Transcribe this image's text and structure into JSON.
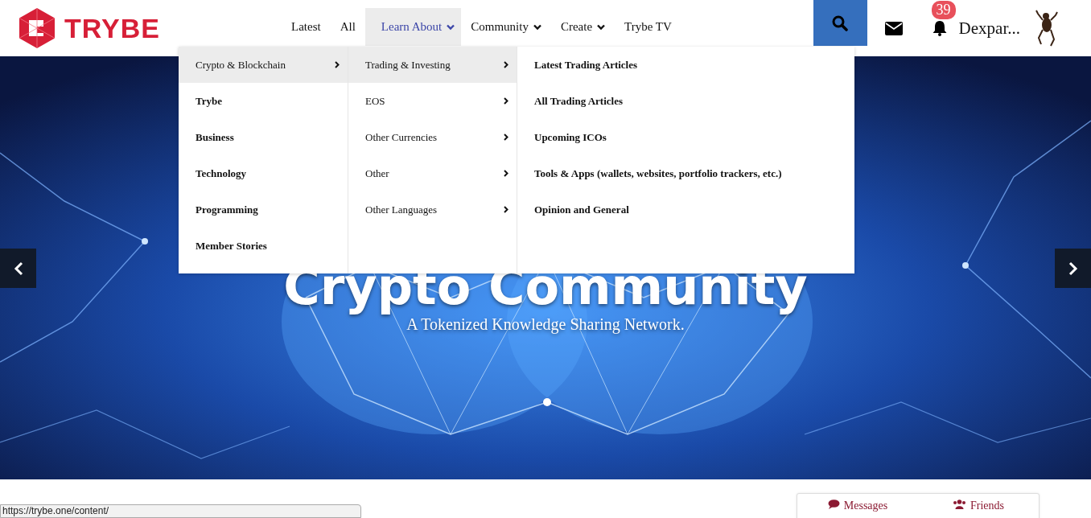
{
  "logo": {
    "text": "TRYBE"
  },
  "nav": [
    {
      "label": "Latest",
      "selected": false,
      "caret": false
    },
    {
      "label": "All",
      "selected": false,
      "caret": false
    },
    {
      "label": "Learn About",
      "selected": true,
      "caret": true
    },
    {
      "label": "Community",
      "selected": false,
      "caret": true
    },
    {
      "label": "Create",
      "selected": false,
      "caret": true
    },
    {
      "label": "Trybe TV",
      "selected": false,
      "caret": false
    }
  ],
  "notifications": {
    "count": "39"
  },
  "user": {
    "name": "Dexpar..."
  },
  "menu": {
    "columns": [
      [
        {
          "label": "Crypto & Blockchain",
          "kind": "submenu",
          "selected": true
        },
        {
          "label": "Trybe",
          "kind": "link",
          "selected": false
        },
        {
          "label": "Business",
          "kind": "link",
          "selected": false
        },
        {
          "label": "Technology",
          "kind": "link",
          "selected": false
        },
        {
          "label": "Programming",
          "kind": "link",
          "selected": false
        },
        {
          "label": "Member Stories",
          "kind": "link",
          "selected": false
        }
      ],
      [
        {
          "label": "Trading & Investing",
          "kind": "submenu",
          "selected": true
        },
        {
          "label": "EOS",
          "kind": "submenu",
          "selected": false
        },
        {
          "label": "Other Currencies",
          "kind": "submenu",
          "selected": false
        },
        {
          "label": "Other",
          "kind": "submenu",
          "selected": false
        },
        {
          "label": "Other Languages",
          "kind": "submenu",
          "selected": false
        }
      ],
      [
        {
          "label": "Latest Trading Articles",
          "kind": "link",
          "selected": false
        },
        {
          "label": "All Trading Articles",
          "kind": "link",
          "selected": false
        },
        {
          "label": "Upcoming ICOs",
          "kind": "link",
          "selected": false
        },
        {
          "label": "Tools & Apps (wallets, websites, portfolio trackers, etc.)",
          "kind": "link",
          "selected": false
        },
        {
          "label": "Opinion and General",
          "kind": "link",
          "selected": false
        }
      ]
    ]
  },
  "hero": {
    "title": "Crypto Community",
    "subtitle": "A Tokenized Knowledge Sharing Network."
  },
  "side_tabs": [
    {
      "label": "Messages",
      "kind": "messages"
    },
    {
      "label": "Friends",
      "kind": "friends"
    }
  ],
  "status_url": "https://trybe.one/content/"
}
